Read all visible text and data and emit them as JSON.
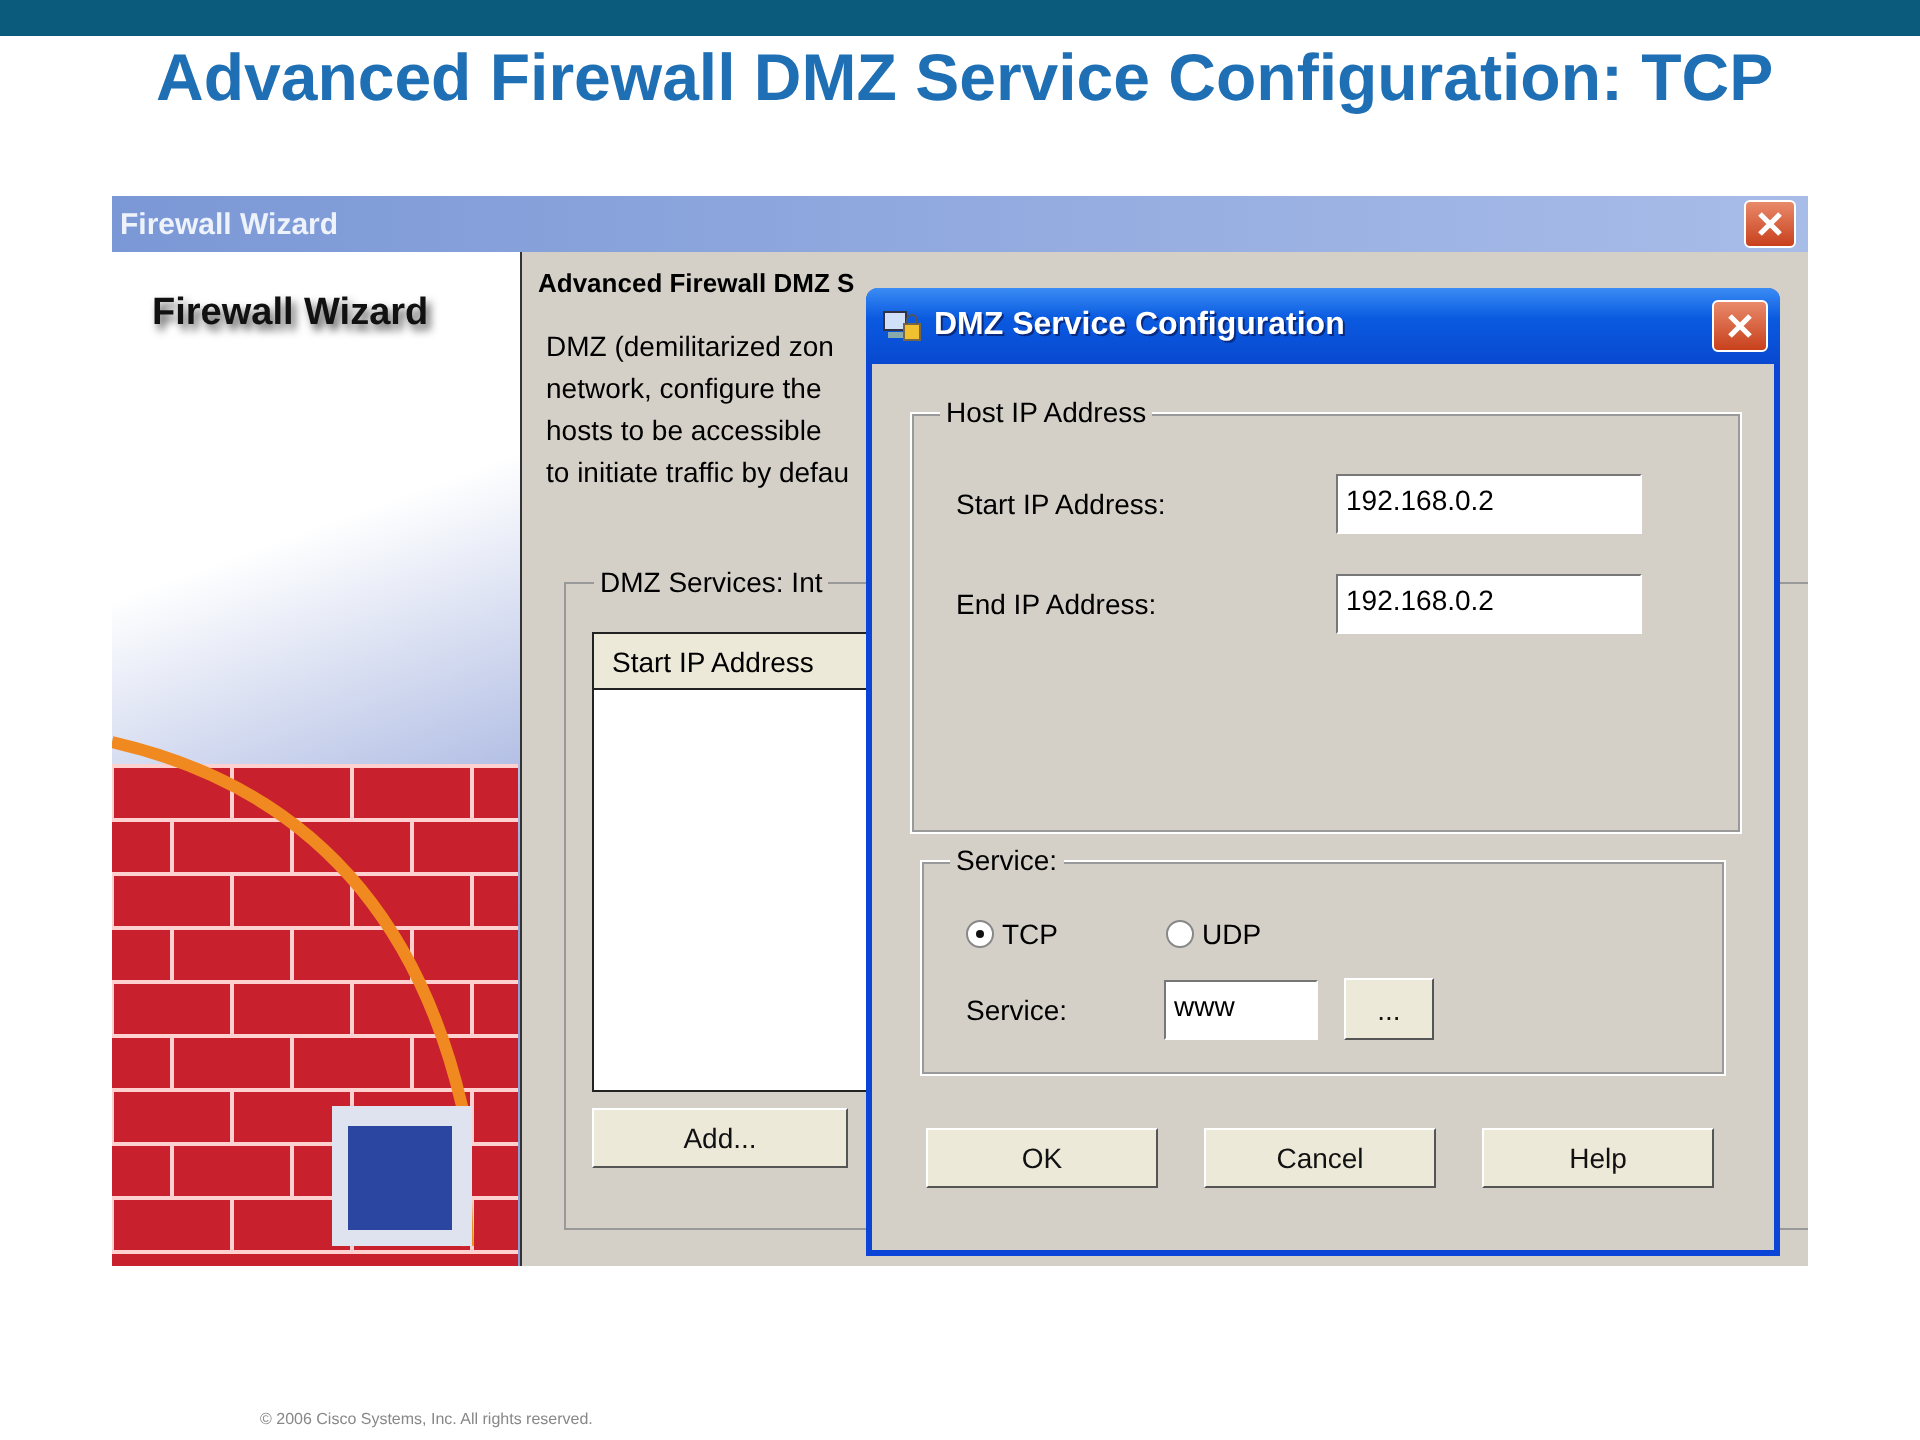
{
  "slide": {
    "title": "Advanced Firewall DMZ Service Configuration: TCP",
    "footer": "© 2006 Cisco Systems, Inc. All rights reserved."
  },
  "wizard": {
    "title": "Firewall Wizard",
    "banner": "Firewall Wizard",
    "heading": "Advanced Firewall DMZ S",
    "description": [
      "DMZ (demilitarized zon",
      "network, configure the",
      "hosts to be accessible",
      "to initiate traffic by defau"
    ],
    "group_label": "DMZ Services: Int",
    "table": {
      "columns": [
        "Start IP Address"
      ]
    },
    "add_button": "Add..."
  },
  "dialog": {
    "title": "DMZ Service Configuration",
    "host_group": {
      "label": "Host IP Address",
      "fields": [
        {
          "label": "Start IP Address:",
          "value": "192.168.0.2"
        },
        {
          "label": "End IP Address:",
          "value": "192.168.0.2"
        }
      ]
    },
    "service_group": {
      "label": "Service:",
      "options": [
        {
          "label": "TCP",
          "selected": true
        },
        {
          "label": "UDP",
          "selected": false
        }
      ],
      "service_label": "Service:",
      "service_value": "www",
      "browse_button": "..."
    },
    "buttons": [
      "OK",
      "Cancel",
      "Help"
    ]
  }
}
